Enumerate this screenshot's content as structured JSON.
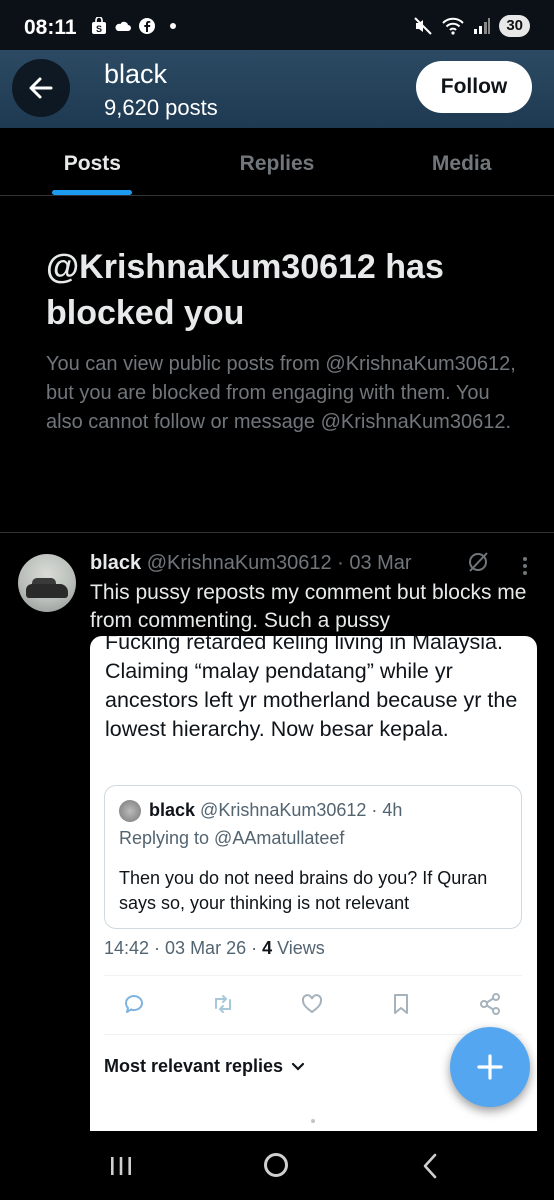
{
  "status_bar": {
    "time": "08:11",
    "battery": "30"
  },
  "header": {
    "name": "black",
    "post_count": "9,620 posts",
    "follow_label": "Follow"
  },
  "tabs": [
    {
      "label": "Posts",
      "active": true
    },
    {
      "label": "Replies",
      "active": false
    },
    {
      "label": "Media",
      "active": false
    }
  ],
  "blocked": {
    "title": "@KrishnaKum30612 has blocked you",
    "body": "You can view public posts from @KrishnaKum30612, but you are blocked from engaging with them. You also cannot follow or message @KrishnaKum30612."
  },
  "post": {
    "name": "black",
    "meta": "@KrishnaKum30612 · 03 Mar",
    "text": "This pussy reposts my comment but blocks me from commenting. Such a pussy",
    "embedded": {
      "text": "Fucking retarded keling living in Malaysia. Claiming “malay pendatang” while yr ancestors left yr motherland because yr the lowest hierarchy. Now besar kepala.",
      "quote": {
        "name": "black",
        "meta": "@KrishnaKum30612 · 4h",
        "replying_to": "Replying to @AAmatullateef",
        "text": "Then you do not need brains do you? If Quran says so, your thinking is not relevant"
      },
      "timestamp": "14:42 · 03 Mar 26 · ",
      "views_count": "4",
      "views_label": " Views",
      "replies_sort": "Most relevant replies"
    }
  },
  "icons": {
    "back": "arrow-left-icon",
    "grok": "grok-icon",
    "more": "more-vertical-icon",
    "reply": "reply-icon",
    "repost": "repost-icon",
    "like": "heart-icon",
    "bookmark": "bookmark-icon",
    "share": "share-icon",
    "compose": "plus-icon"
  },
  "colors": {
    "accent": "#1d9bf0",
    "header_bg": "#2c4a63",
    "fab": "#55a6f0",
    "muted_text": "#71767b"
  }
}
